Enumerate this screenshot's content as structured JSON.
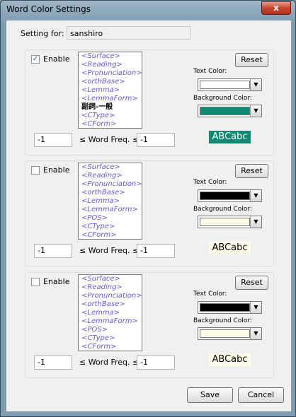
{
  "window": {
    "title": "Word Color Settings",
    "close_glyph": "x"
  },
  "setting_for": {
    "label": "Setting for:",
    "value": "sanshiro"
  },
  "groups": [
    {
      "enabled": true,
      "enable_label": "Enable",
      "items": [
        "<Surface>",
        "<Reading>",
        "<Pronunciation>",
        "<orthBase>",
        "<Lemma>",
        "<LemmaForm>",
        "副詞-一般",
        "<CType>",
        "<CForm>"
      ],
      "reset_label": "Reset",
      "text_color_label": "Text Color:",
      "text_color": "#ffffff",
      "bg_color_label": "Background Color:",
      "bg_color": "#0e8a72",
      "preview_text": "ABCabc",
      "preview_fg": "#ffffff",
      "preview_bg": "#0e8a72",
      "freq_min": "-1",
      "freq_label": "≤ Word Freq. ≤",
      "freq_max": "-1"
    },
    {
      "enabled": false,
      "enable_label": "Enable",
      "items": [
        "<Surface>",
        "<Reading>",
        "<Pronunciation>",
        "<orthBase>",
        "<Lemma>",
        "<LemmaForm>",
        "<POS>",
        "<CType>",
        "<CForm>"
      ],
      "reset_label": "Reset",
      "text_color_label": "Text Color:",
      "text_color": "#000000",
      "bg_color_label": "Background Color:",
      "bg_color": "#fffbe8",
      "preview_text": "ABCabc",
      "preview_fg": "#000000",
      "preview_bg": "#fffbe8",
      "freq_min": "-1",
      "freq_label": "≤ Word Freq. ≤",
      "freq_max": "-1"
    },
    {
      "enabled": false,
      "enable_label": "Enable",
      "items": [
        "<Surface>",
        "<Reading>",
        "<Pronunciation>",
        "<orthBase>",
        "<Lemma>",
        "<LemmaForm>",
        "<POS>",
        "<CType>",
        "<CForm>"
      ],
      "reset_label": "Reset",
      "text_color_label": "Text Color:",
      "text_color": "#000000",
      "bg_color_label": "Background Color:",
      "bg_color": "#fffbe8",
      "preview_text": "ABCabc",
      "preview_fg": "#000000",
      "preview_bg": "#fffbe8",
      "freq_min": "-1",
      "freq_label": "≤ Word Freq. ≤",
      "freq_max": "-1"
    }
  ],
  "buttons": {
    "save": "Save",
    "cancel": "Cancel"
  },
  "icons": {
    "checkmark": "checkmark-icon",
    "dropdown": "chevron-down-icon",
    "close": "close-icon"
  }
}
